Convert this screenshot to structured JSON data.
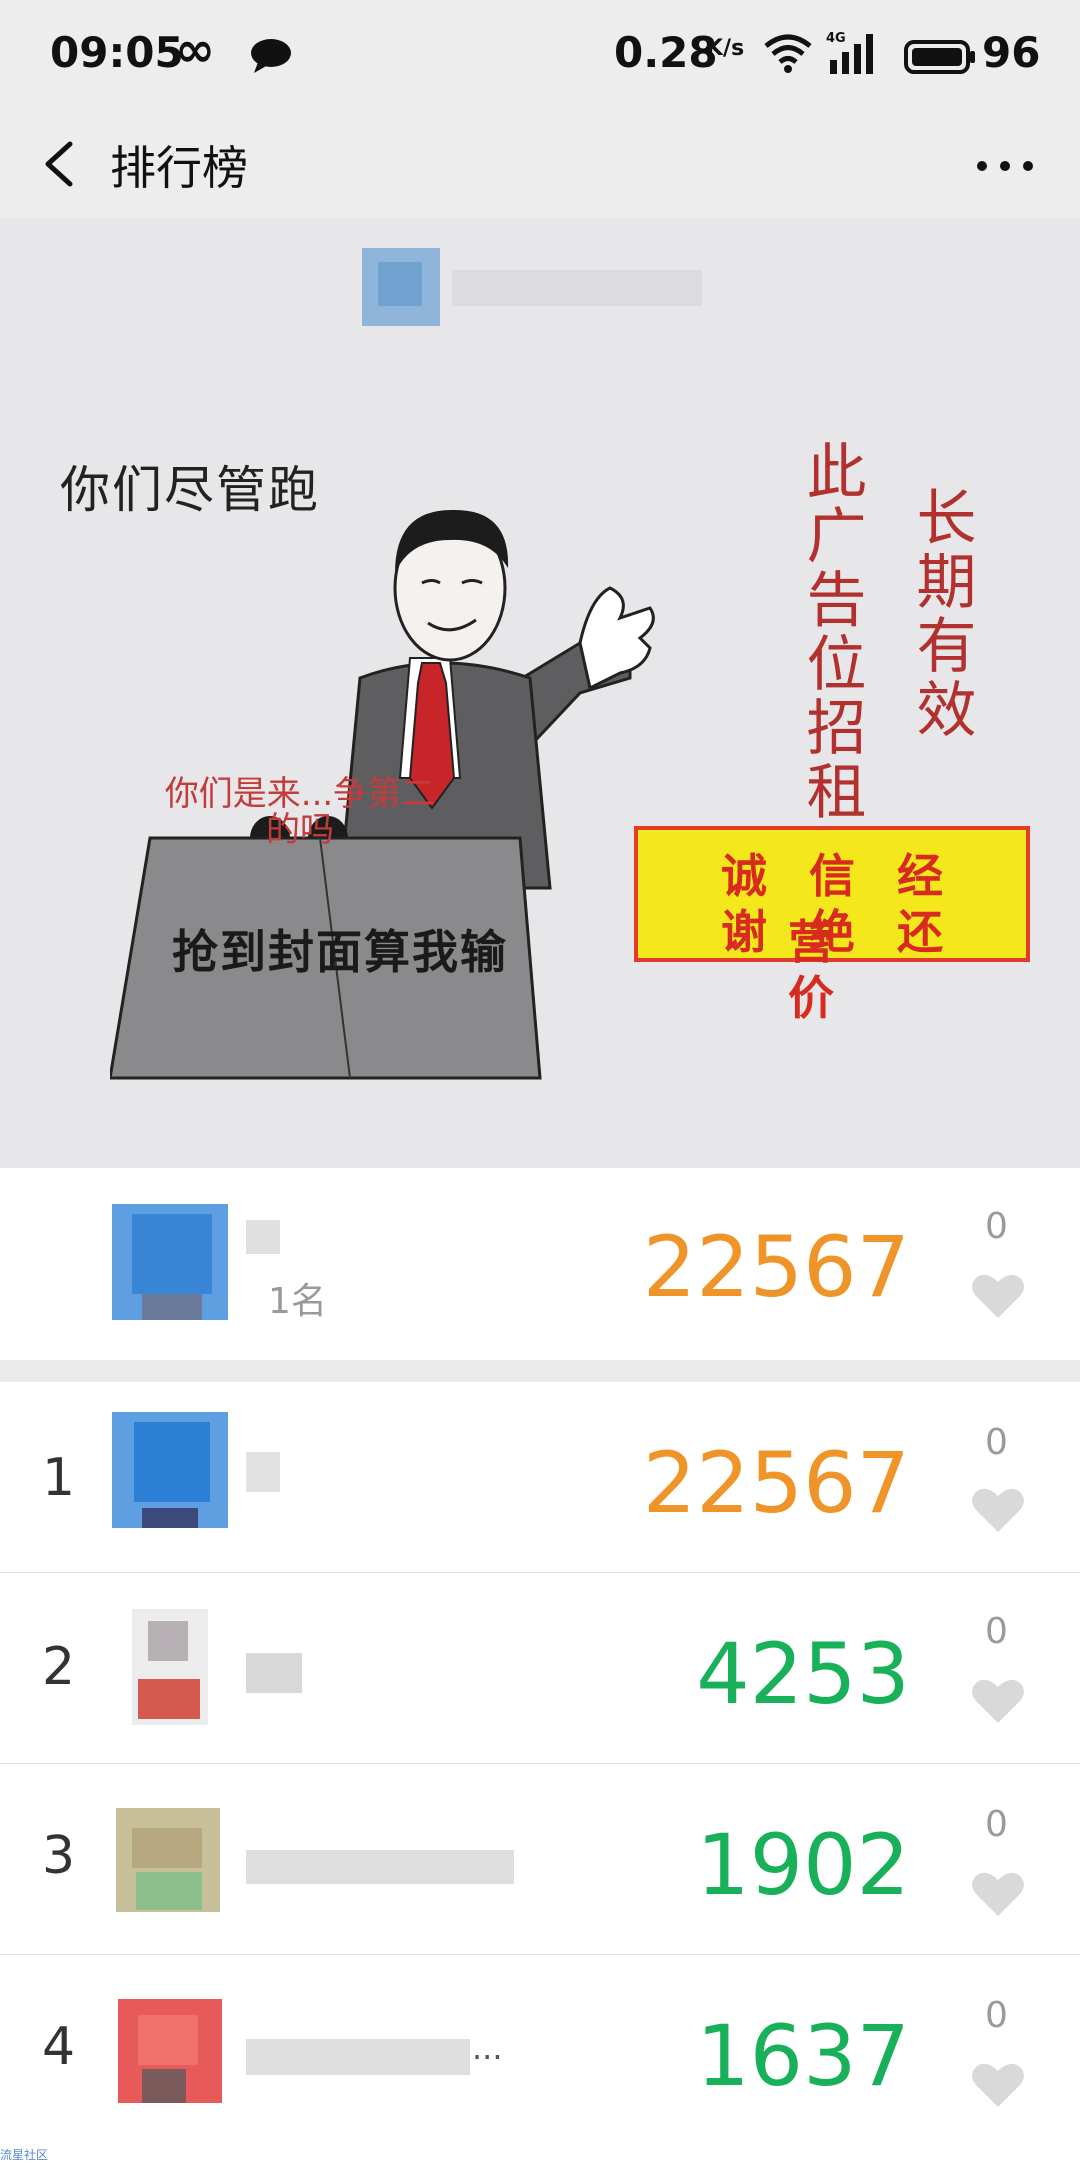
{
  "status_bar": {
    "time": "09:05",
    "infinity": "∞",
    "speed": "0.28",
    "speed_unit": "K/s",
    "network": "4G",
    "battery": "96"
  },
  "nav": {
    "title": "排行榜"
  },
  "cover": {
    "text_left": "你们尽管跑",
    "text_bottom": "抢到封面算我输",
    "podium_text": "你们是来...争第二的吗",
    "vertical_1": "此广告位招租",
    "vertical_2": "长期有效",
    "sign_line_1": "诚信经营",
    "sign_line_2": "谢绝还价"
  },
  "my_rank": {
    "name_suffix": "1名",
    "score": "22567",
    "likes": "0"
  },
  "rankings": [
    {
      "rank": "1",
      "score": "22567",
      "likes": "0"
    },
    {
      "rank": "2",
      "score": "4253",
      "likes": "0"
    },
    {
      "rank": "3",
      "score": "1902",
      "likes": "0"
    },
    {
      "rank": "4",
      "score": "1637",
      "likes": "0",
      "name_tail": "..."
    }
  ],
  "watermark": "流星社区",
  "colors": {
    "first_place": "#ef9429",
    "others": "#19b05a",
    "heart": "#d9d9d9"
  }
}
